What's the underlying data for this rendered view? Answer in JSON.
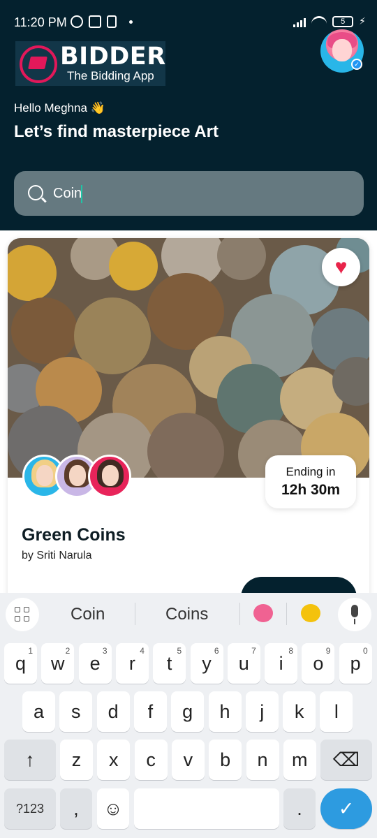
{
  "status_bar": {
    "time": "11:20 PM",
    "battery": "5"
  },
  "brand": {
    "title": "BIDDER",
    "subtitle": "The Bidding App"
  },
  "greeting": "Hello Meghna 👋",
  "headline": "Let’s find masterpiece Art",
  "search": {
    "value": "Coin"
  },
  "card": {
    "ending_label": "Ending in",
    "ending_value": "12h 30m",
    "title": "Green Coins",
    "author": "by Sriti Narula"
  },
  "keyboard": {
    "suggestions": [
      "Coin",
      "Coins"
    ],
    "row1": [
      {
        "key": "q",
        "hint": "1"
      },
      {
        "key": "w",
        "hint": "2"
      },
      {
        "key": "e",
        "hint": "3"
      },
      {
        "key": "r",
        "hint": "4"
      },
      {
        "key": "t",
        "hint": "5"
      },
      {
        "key": "y",
        "hint": "6"
      },
      {
        "key": "u",
        "hint": "7"
      },
      {
        "key": "i",
        "hint": "8"
      },
      {
        "key": "o",
        "hint": "9"
      },
      {
        "key": "p",
        "hint": "0"
      }
    ],
    "row2": [
      "a",
      "s",
      "d",
      "f",
      "g",
      "h",
      "j",
      "k",
      "l"
    ],
    "row3": [
      "z",
      "x",
      "c",
      "v",
      "b",
      "n",
      "m"
    ],
    "shift_label": "↑",
    "backspace_label": "⌫",
    "symbols_label": "?123",
    "comma_label": ",",
    "emoji_label": "☺",
    "period_label": ".",
    "enter_label": "✓"
  }
}
